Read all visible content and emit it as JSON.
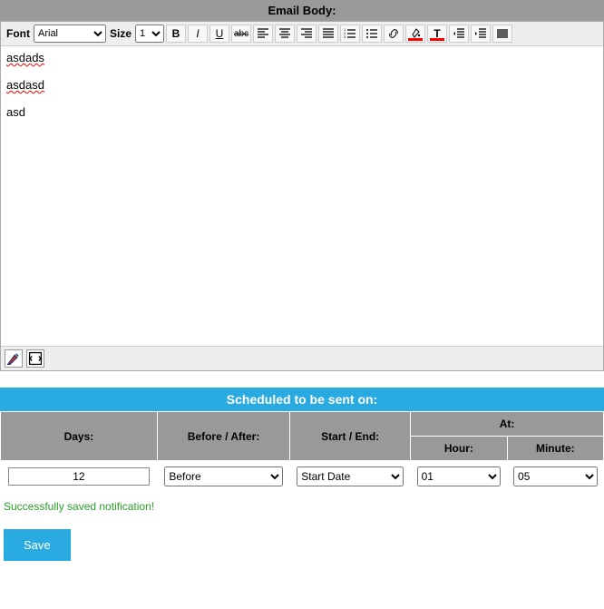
{
  "header": {
    "title": "Email Body:"
  },
  "editor": {
    "font_label": "Font",
    "font_value": "Arial",
    "size_label": "Size",
    "size_value": "1",
    "content": {
      "line1": "asdads",
      "line2": "asdasd",
      "line3": "asd"
    }
  },
  "schedule": {
    "title": "Scheduled to be sent on:",
    "cols": {
      "days": "Days:",
      "before_after": "Before / After:",
      "start_end": "Start / End:",
      "at": "At:",
      "hour": "Hour:",
      "minute": "Minute:"
    },
    "values": {
      "days": "12",
      "before_after": "Before",
      "start_end": "Start Date",
      "hour": "01",
      "minute": "05"
    }
  },
  "status": "Successfully saved notification!",
  "buttons": {
    "save": "Save"
  }
}
